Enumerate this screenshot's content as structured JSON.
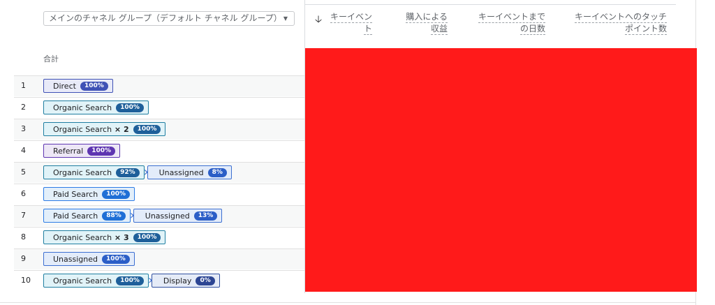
{
  "dimension": {
    "selected": "メインのチャネル グループ（デフォルト チャネル グループ）"
  },
  "total_label": "合計",
  "metrics": [
    {
      "line1": "キーイベン",
      "line2": "ト"
    },
    {
      "line1": "購入による",
      "line2": "収益"
    },
    {
      "line1": "キーイベントまで",
      "line2": "の日数"
    },
    {
      "line1": "キーイベントへのタッチ",
      "line2": "ポイント数"
    }
  ],
  "sort_icon": "arrow-down-icon",
  "rows": [
    {
      "index": "1",
      "segments": [
        {
          "label": "Direct",
          "pct": "100%",
          "type": "direct"
        }
      ]
    },
    {
      "index": "2",
      "segments": [
        {
          "label": "Organic Search",
          "pct": "100%",
          "type": "organic"
        }
      ]
    },
    {
      "index": "3",
      "segments": [
        {
          "label": "Organic Search",
          "times": "× 2",
          "pct": "100%",
          "type": "organic"
        }
      ]
    },
    {
      "index": "4",
      "segments": [
        {
          "label": "Referral",
          "pct": "100%",
          "type": "referral"
        }
      ]
    },
    {
      "index": "5",
      "segments": [
        {
          "label": "Organic Search",
          "pct": "92%",
          "type": "organic"
        },
        {
          "label": "Unassigned",
          "pct": "8%",
          "type": "unassigned"
        }
      ]
    },
    {
      "index": "6",
      "segments": [
        {
          "label": "Paid Search",
          "pct": "100%",
          "type": "paid"
        }
      ]
    },
    {
      "index": "7",
      "segments": [
        {
          "label": "Paid Search",
          "pct": "88%",
          "type": "paid"
        },
        {
          "label": "Unassigned",
          "pct": "13%",
          "type": "unassigned"
        }
      ]
    },
    {
      "index": "8",
      "segments": [
        {
          "label": "Organic Search",
          "times": "× 3",
          "pct": "100%",
          "type": "organic"
        }
      ]
    },
    {
      "index": "9",
      "segments": [
        {
          "label": "Unassigned",
          "pct": "100%",
          "type": "unassigned"
        }
      ]
    },
    {
      "index": "10",
      "segments": [
        {
          "label": "Organic Search",
          "pct": "100%",
          "type": "organic"
        },
        {
          "label": "Display",
          "pct": "0%",
          "type": "display"
        }
      ]
    }
  ]
}
